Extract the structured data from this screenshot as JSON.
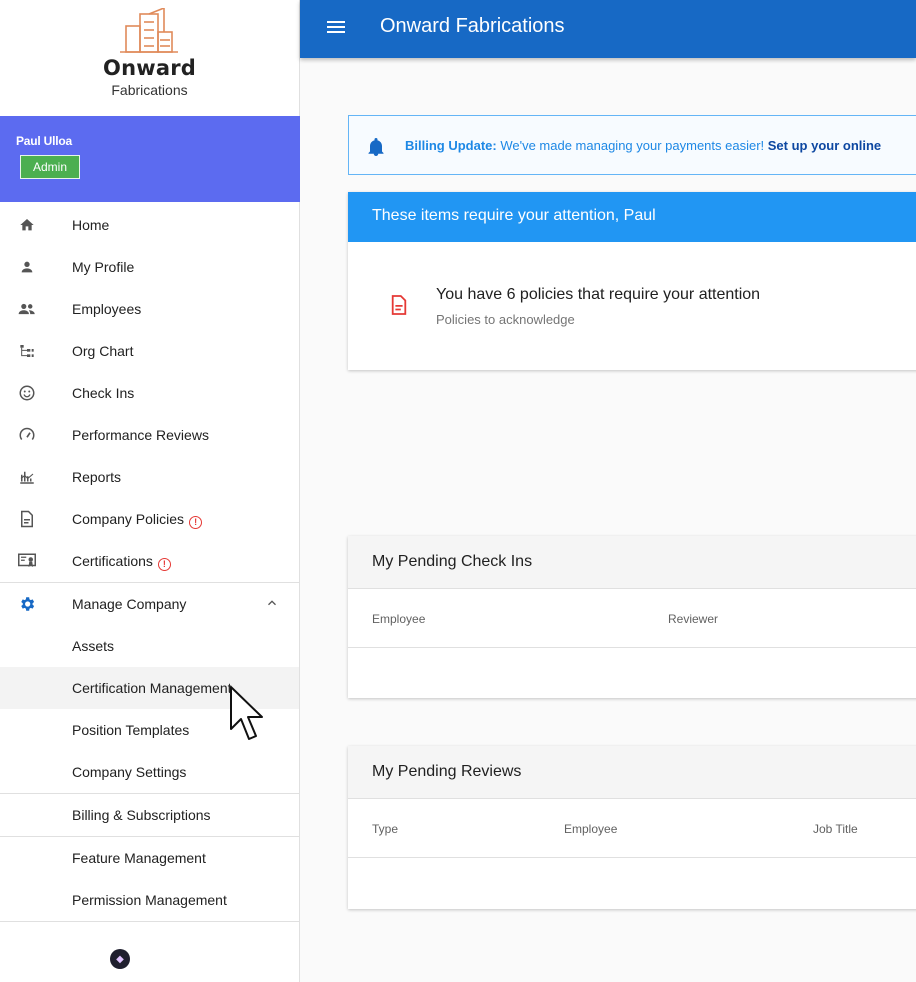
{
  "brand": {
    "name": "Onward",
    "subname": "Fabrications",
    "accent": "#1769c5",
    "user_card_color": "#5c6bf0",
    "logo_color": "#e08a5a"
  },
  "user": {
    "name": "Paul Ulloa",
    "role": "Admin"
  },
  "sidebar": {
    "items": [
      {
        "label": "Home",
        "icon": "home-icon"
      },
      {
        "label": "My Profile",
        "icon": "person-icon"
      },
      {
        "label": "Employees",
        "icon": "people-icon"
      },
      {
        "label": "Org Chart",
        "icon": "org-chart-icon"
      },
      {
        "label": "Check Ins",
        "icon": "smiley-icon"
      },
      {
        "label": "Performance Reviews",
        "icon": "speedometer-icon"
      },
      {
        "label": "Reports",
        "icon": "chart-icon"
      },
      {
        "label": "Company Policies",
        "icon": "document-icon",
        "alert": "!"
      },
      {
        "label": "Certifications",
        "icon": "certificate-icon",
        "alert": "!"
      }
    ],
    "manage": {
      "label": "Manage Company",
      "icon": "gear-icon",
      "expanded_icon": "chevron-up-icon",
      "subitems": [
        {
          "label": "Assets"
        },
        {
          "label": "Certification Management"
        },
        {
          "label": "Position Templates"
        },
        {
          "label": "Company Settings"
        }
      ]
    },
    "bottom_items": [
      {
        "label": "Billing & Subscriptions"
      },
      {
        "label": "Feature Management"
      },
      {
        "label": "Permission Management"
      }
    ]
  },
  "topbar": {
    "title": "Onward Fabrications"
  },
  "billing": {
    "prefix": "Billing Update:",
    "message": " We've made managing your payments easier! ",
    "cta": "Set up your online"
  },
  "attention": {
    "title": "These items require your attention, Paul",
    "item_title": "You have 6 policies that require your attention",
    "item_subtitle": "Policies to acknowledge"
  },
  "checkins": {
    "title": "My Pending Check Ins",
    "columns": [
      "Employee",
      "Reviewer"
    ]
  },
  "reviews": {
    "title": "My Pending Reviews",
    "columns": [
      "Type",
      "Employee",
      "Job Title"
    ]
  }
}
